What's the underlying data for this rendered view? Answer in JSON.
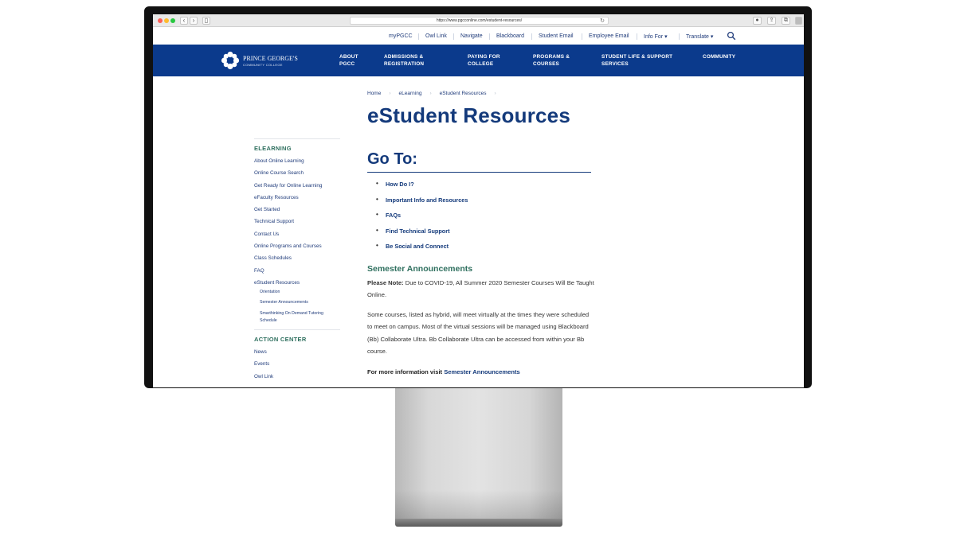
{
  "browser": {
    "url": "https://www.pgcconline.com/estudent-resources/",
    "back": "‹",
    "forward": "›"
  },
  "utility_nav": [
    "myPGCC",
    "Owl Link",
    "Navigate",
    "Blackboard",
    "Student Email",
    "Employee Email",
    "Info For ▾",
    "Translate ▾"
  ],
  "logo": {
    "name": "PRINCE GEORGE'S",
    "sub": "COMMUNITY COLLEGE"
  },
  "main_nav": [
    {
      "line1": "ABOUT",
      "line2": "PGCC"
    },
    {
      "line1": "ADMISSIONS &",
      "line2": "REGISTRATION"
    },
    {
      "line1": "PAYING FOR",
      "line2": "COLLEGE"
    },
    {
      "line1": "PROGRAMS &",
      "line2": "COURSES"
    },
    {
      "line1": "STUDENT LIFE & SUPPORT",
      "line2": "SERVICES"
    },
    {
      "line1": "COMMUNITY",
      "line2": ""
    }
  ],
  "breadcrumb": [
    "Home",
    "eLearning",
    "eStudent Resources"
  ],
  "page_title": "eStudent Resources",
  "sidebar": {
    "heading": "ELEARNING",
    "items": [
      "About Online Learning",
      "Online Course Search",
      "Get Ready for Online Learning",
      "eFaculty Resources",
      "Get Started",
      "Technical Support",
      "Contact Us",
      "Online Programs and Courses",
      "Class Schedules",
      "FAQ",
      "eStudent Resources"
    ],
    "subitems": [
      "Orientation",
      "Semester Announcements",
      "Smarthinking On Demand Tutoring Schedule"
    ],
    "heading2": "ACTION CENTER",
    "items2": [
      "News",
      "Events",
      "Owl Link"
    ]
  },
  "goto": {
    "title": "Go To:",
    "items": [
      "How Do I?",
      "Important Info and Resources",
      "FAQs",
      "Find Technical Support",
      "Be Social and Connect"
    ]
  },
  "announcements": {
    "title": "Semester Announcements",
    "note_label": "Please Note:",
    "note_text": " Due to COVID-19, All Summer 2020 Semester Courses Will Be Taught Online.",
    "para2": "Some courses, listed as hybrid, will meet virtually at the times they were scheduled to meet on campus. Most of the virtual sessions will be managed using Blackboard (Bb) Collaborate Ultra. Bb Collaborate Ultra can be accessed from within your Bb course.",
    "more_label": "For more information visit ",
    "more_link": "Semester Announcements"
  },
  "colors": {
    "nav_blue": "#0b3a8c",
    "title_blue": "#143a7b",
    "accent_green": "#2e6f5e"
  }
}
